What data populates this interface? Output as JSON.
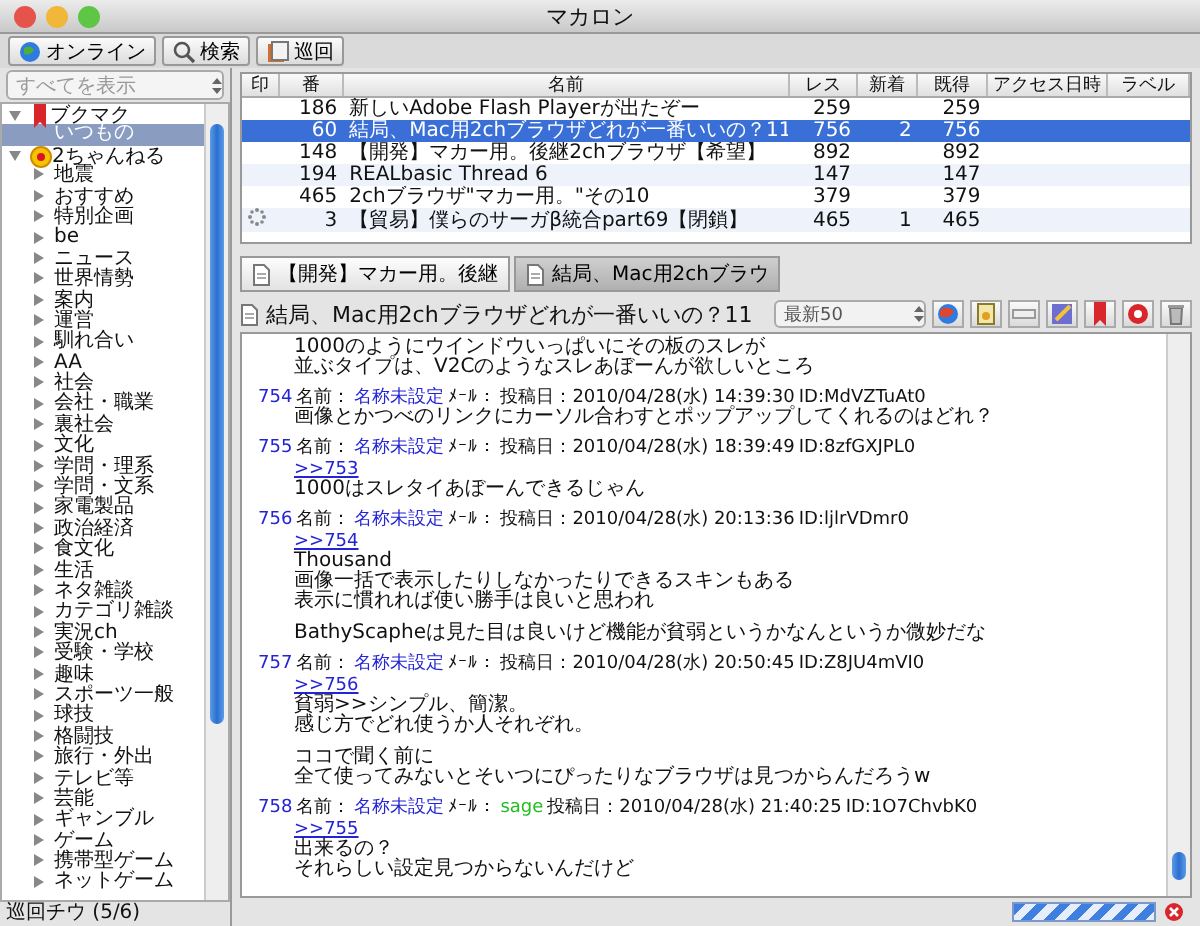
{
  "window": {
    "title": "マカロン"
  },
  "toolbar": [
    {
      "kind": "online",
      "label": "オンライン"
    },
    {
      "kind": "search",
      "label": "検索"
    },
    {
      "kind": "patrol",
      "label": "巡回"
    }
  ],
  "sidebar": {
    "filter": "すべてを表示",
    "tree": [
      {
        "kind": "bookmarks",
        "label": "ブクマク",
        "expanded": true,
        "selected": false,
        "children": [
          {
            "label": "いつもの",
            "selected": true
          }
        ]
      },
      {
        "kind": "board_group",
        "label": "2ちゃんねる",
        "expanded": true,
        "selected": false,
        "children": [
          {
            "label": "地震",
            "expanded": false,
            "selected": false
          },
          {
            "label": "おすすめ",
            "expanded": false,
            "selected": false
          },
          {
            "label": "特別企画",
            "expanded": false,
            "selected": false
          },
          {
            "label": "be",
            "expanded": false,
            "selected": false
          },
          {
            "label": "ニュース",
            "expanded": false,
            "selected": false
          },
          {
            "label": "世界情勢",
            "expanded": false,
            "selected": false
          },
          {
            "label": "案内",
            "expanded": false,
            "selected": false
          },
          {
            "label": "運営",
            "expanded": false,
            "selected": false
          },
          {
            "label": "馴れ合い",
            "expanded": false,
            "selected": false
          },
          {
            "label": "AA",
            "expanded": false,
            "selected": false
          },
          {
            "label": "社会",
            "expanded": false,
            "selected": false
          },
          {
            "label": "会社・職業",
            "expanded": false,
            "selected": false
          },
          {
            "label": "裏社会",
            "expanded": false,
            "selected": false
          },
          {
            "label": "文化",
            "expanded": false,
            "selected": false
          },
          {
            "label": "学問・理系",
            "expanded": false,
            "selected": false
          },
          {
            "label": "学問・文系",
            "expanded": false,
            "selected": false
          },
          {
            "label": "家電製品",
            "expanded": false,
            "selected": false
          },
          {
            "label": "政治経済",
            "expanded": false,
            "selected": false
          },
          {
            "label": "食文化",
            "expanded": false,
            "selected": false
          },
          {
            "label": "生活",
            "expanded": false,
            "selected": false
          },
          {
            "label": "ネタ雑談",
            "expanded": false,
            "selected": false
          },
          {
            "label": "カテゴリ雑談",
            "expanded": false,
            "selected": false
          },
          {
            "label": "実況ch",
            "expanded": false,
            "selected": false
          },
          {
            "label": "受験・学校",
            "expanded": false,
            "selected": false
          },
          {
            "label": "趣味",
            "expanded": false,
            "selected": false
          },
          {
            "label": "スポーツ一般",
            "expanded": false,
            "selected": false
          },
          {
            "label": "球技",
            "expanded": false,
            "selected": false
          },
          {
            "label": "格闘技",
            "expanded": false,
            "selected": false
          },
          {
            "label": "旅行・外出",
            "expanded": false,
            "selected": false
          },
          {
            "label": "テレビ等",
            "expanded": false,
            "selected": false
          },
          {
            "label": "芸能",
            "expanded": false,
            "selected": false
          },
          {
            "label": "ギャンブル",
            "expanded": false,
            "selected": false
          },
          {
            "label": "ゲーム",
            "expanded": false,
            "selected": false
          },
          {
            "label": "携帯型ゲーム",
            "expanded": false,
            "selected": false
          },
          {
            "label": "ネットゲーム",
            "expanded": false,
            "selected": false
          }
        ]
      }
    ],
    "status": "巡回チウ (5/6)"
  },
  "table": {
    "columns": [
      "印",
      "番",
      "名前",
      "レス",
      "新着",
      "既得",
      "アクセス日時",
      "ラベル"
    ],
    "rows": [
      {
        "loading": false,
        "selected": false,
        "number": "186",
        "name": "新しいAdobe Flash Playerが出たぞー",
        "res": "259",
        "fetched": "259"
      },
      {
        "loading": false,
        "selected": true,
        "number": "60",
        "name": "結局、Mac用2chブラウザどれが一番いいの？11",
        "res": "756",
        "new": "2",
        "fetched": "756"
      },
      {
        "loading": false,
        "selected": false,
        "number": "148",
        "name": "【開発】マカー用。後継2chブラウザ【希望】",
        "res": "892",
        "fetched": "892"
      },
      {
        "loading": false,
        "selected": false,
        "number": "194",
        "name": "REALbasic Thread 6",
        "res": "147",
        "fetched": "147"
      },
      {
        "loading": false,
        "selected": false,
        "number": "465",
        "name": "2chブラウザ\"マカー用。\"その10",
        "res": "379",
        "fetched": "379"
      },
      {
        "loading": true,
        "selected": false,
        "number": "3",
        "name": "【貿易】僕らのサーガβ統合part69【閉鎖】",
        "res": "465",
        "new": "1",
        "fetched": "465"
      }
    ]
  },
  "thread_tabs": [
    {
      "label": "【開発】マカー用。後継",
      "selected": false
    },
    {
      "label": "結局、Mac用2chブラウ",
      "selected": true
    }
  ],
  "thread": {
    "title": "結局、Mac用2chブラウザどれが一番いいの？11",
    "range": "最新50",
    "posts": [
      {
        "kind": "fragment",
        "paragraphs": [
          [
            "1000のようにウインドウいっぱいにその板のスレが",
            "並ぶタイプは、V2Cのようなスレあぼーんが欲しいところ"
          ]
        ]
      },
      {
        "kind": "post",
        "number": "754",
        "name_label": "名前：",
        "name": "名称未設定",
        "mail_label": "ﾒｰﾙ：",
        "date": "投稿日：2010/04/28(水) 14:39:30",
        "id": "ID:MdVZTuAt0",
        "paragraphs": [
          [
            "画像とかつべのリンクにカーソル合わすとポップアップしてくれるのはどれ？"
          ]
        ]
      },
      {
        "kind": "post",
        "number": "755",
        "name_label": "名前：",
        "name": "名称未設定",
        "mail_label": "ﾒｰﾙ：",
        "date": "投稿日：2010/04/28(水) 18:39:49",
        "id": "ID:8zfGXJPL0",
        "reply": ">>753",
        "paragraphs": [
          [
            "1000はスレタイあぼーんできるじゃん"
          ]
        ]
      },
      {
        "kind": "post",
        "number": "756",
        "name_label": "名前：",
        "name": "名称未設定",
        "mail_label": "ﾒｰﾙ：",
        "date": "投稿日：2010/04/28(水) 20:13:36",
        "id": "ID:ljlrVDmr0",
        "reply": ">>754",
        "paragraphs": [
          [
            "Thousand",
            "画像一括で表示したりしなかったりできるスキンもある",
            "表示に慣れれば使い勝手は良いと思われ"
          ],
          [
            "BathyScapheは見た目は良いけど機能が貧弱というかなんというか微妙だな"
          ]
        ]
      },
      {
        "kind": "post",
        "number": "757",
        "name_label": "名前：",
        "name": "名称未設定",
        "mail_label": "ﾒｰﾙ：",
        "date": "投稿日：2010/04/28(水) 20:50:45",
        "id": "ID:Z8JU4mVI0",
        "reply": ">>756",
        "paragraphs": [
          [
            "貧弱>>シンプル、簡潔。",
            "感じ方でどれ使うか人それぞれ。"
          ],
          [
            "ココで聞く前に",
            "全て使ってみないとそいつにぴったりなブラウザは見つからんだろうw"
          ]
        ]
      },
      {
        "kind": "post",
        "number": "758",
        "name_label": "名前：",
        "name": "名称未設定",
        "mail_label": "ﾒｰﾙ：",
        "mail": "sage",
        "date": "投稿日：2010/04/28(水) 21:40:25",
        "id": "ID:1O7ChvbK0",
        "reply": ">>755",
        "paragraphs": [
          [
            "出来るの？",
            "それらしい設定見つからないんだけど"
          ]
        ]
      }
    ]
  }
}
